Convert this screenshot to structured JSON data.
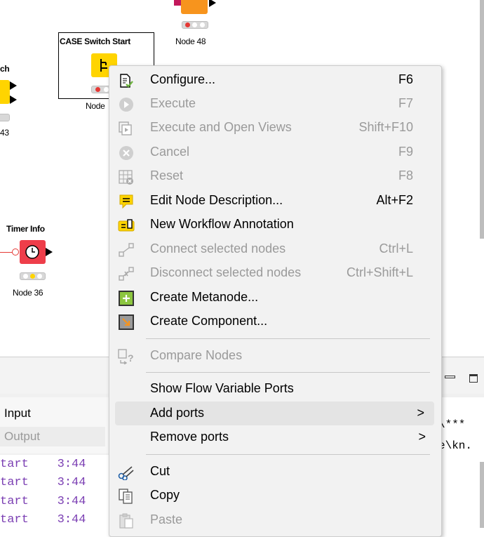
{
  "canvas": {
    "nodes": {
      "node48": {
        "sub": "Node 48",
        "color": "#f7941d"
      },
      "case_switch": {
        "title": "CASE Switch Start",
        "sub": "Node",
        "color": "#ffd400"
      },
      "partial_left": {
        "title": "ch",
        "sub": "43",
        "color": "#ffd400"
      },
      "timer": {
        "title": "Timer Info",
        "sub": "Node 36",
        "color": "#ee3e4a"
      }
    }
  },
  "bottom": {
    "tabs": [
      {
        "label": "Input"
      },
      {
        "label": "Output"
      }
    ],
    "console_lines": [
      {
        "text": "tart",
        "time": "3:44"
      },
      {
        "text": "tart",
        "time": "3:44"
      },
      {
        "text": "tart",
        "time": "3:44"
      },
      {
        "text": "tart",
        "time": "3:44"
      }
    ],
    "right_lines": [
      "\\***",
      "e\\kn."
    ]
  },
  "context_menu": {
    "items": [
      {
        "id": "configure",
        "label": "Configure...",
        "shortcut": "F6",
        "enabled": true,
        "icon": "configure-icon"
      },
      {
        "id": "execute",
        "label": "Execute",
        "shortcut": "F7",
        "enabled": false,
        "icon": "play-icon"
      },
      {
        "id": "execute-open-views",
        "label": "Execute and Open Views",
        "shortcut": "Shift+F10",
        "enabled": false,
        "icon": "execute-views-icon"
      },
      {
        "id": "cancel",
        "label": "Cancel",
        "shortcut": "F9",
        "enabled": false,
        "icon": "cancel-icon"
      },
      {
        "id": "reset",
        "label": "Reset",
        "shortcut": "F8",
        "enabled": false,
        "icon": "reset-icon"
      },
      {
        "id": "edit-description",
        "label": "Edit Node Description...",
        "shortcut": "Alt+F2",
        "enabled": true,
        "icon": "description-icon"
      },
      {
        "id": "new-annotation",
        "label": "New Workflow Annotation",
        "shortcut": "",
        "enabled": true,
        "icon": "annotation-icon"
      },
      {
        "id": "connect",
        "label": "Connect selected nodes",
        "shortcut": "Ctrl+L",
        "enabled": false,
        "icon": "connect-icon"
      },
      {
        "id": "disconnect",
        "label": "Disconnect selected nodes",
        "shortcut": "Ctrl+Shift+L",
        "enabled": false,
        "icon": "disconnect-icon"
      },
      {
        "id": "create-metanode",
        "label": "Create Metanode...",
        "shortcut": "",
        "enabled": true,
        "icon": "metanode-icon"
      },
      {
        "id": "create-component",
        "label": "Create Component...",
        "shortcut": "",
        "enabled": true,
        "icon": "component-icon"
      },
      {
        "id": "compare-nodes",
        "label": "Compare Nodes",
        "shortcut": "",
        "enabled": false,
        "icon": "compare-icon"
      },
      {
        "id": "show-flow-var",
        "label": "Show Flow Variable Ports",
        "shortcut": "",
        "enabled": true,
        "icon": ""
      },
      {
        "id": "add-ports",
        "label": "Add ports",
        "shortcut": "",
        "enabled": true,
        "icon": "",
        "submenu": ">"
      },
      {
        "id": "remove-ports",
        "label": "Remove ports",
        "shortcut": "",
        "enabled": true,
        "icon": "",
        "submenu": ">"
      },
      {
        "id": "cut",
        "label": "Cut",
        "shortcut": "",
        "enabled": true,
        "icon": "scissors-icon"
      },
      {
        "id": "copy",
        "label": "Copy",
        "shortcut": "",
        "enabled": true,
        "icon": "copy-icon"
      },
      {
        "id": "paste",
        "label": "Paste",
        "shortcut": "",
        "enabled": false,
        "icon": "paste-icon"
      }
    ]
  },
  "colors": {
    "accent_yellow": "#ffd400",
    "accent_green": "#8cc63f",
    "disabled_text": "#9a9a9a"
  }
}
